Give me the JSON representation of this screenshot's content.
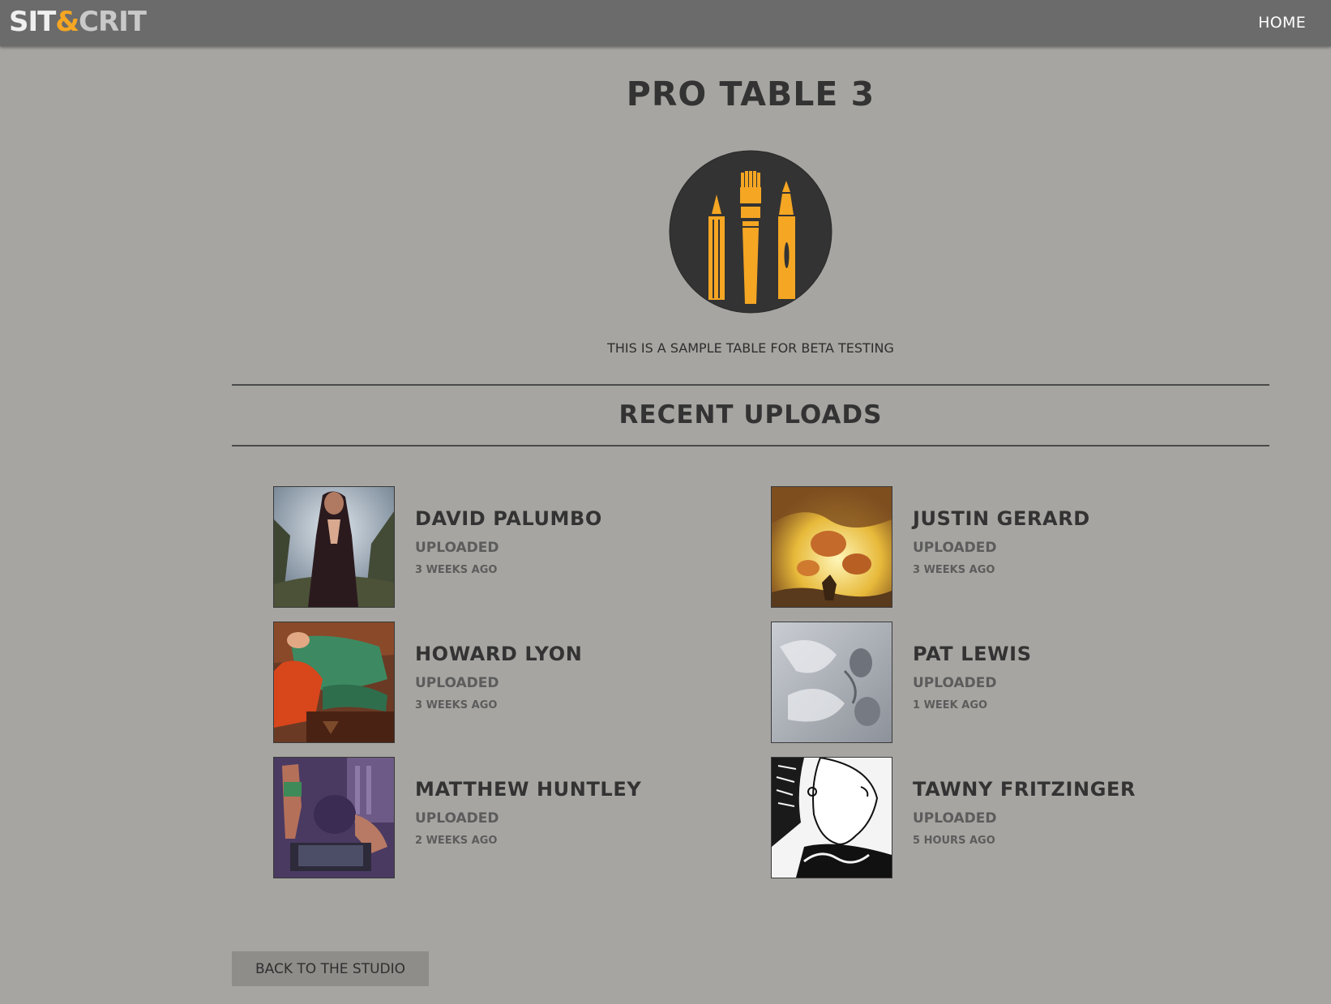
{
  "colors": {
    "page_background": "#a6a5a1",
    "topbar": "#6b6b6b",
    "accent": "#f5a623",
    "text_dark": "#333333",
    "text_muted": "#5c5c5c"
  },
  "header": {
    "logo": {
      "part1": "SIT",
      "part2": "&",
      "part3": "CRIT"
    },
    "nav": {
      "home_label": "HOME"
    }
  },
  "main": {
    "title": "PRO TABLE 3",
    "table_icon": "pencil-brush-pen-icon",
    "description": "THIS IS A SAMPLE TABLE FOR BETA TESTING",
    "recent_uploads": {
      "heading": "RECENT UPLOADS",
      "items": [
        {
          "artist": "DAVID PALUMBO",
          "status": "UPLOADED",
          "time": "3 WEEKS AGO"
        },
        {
          "artist": "JUSTIN GERARD",
          "status": "UPLOADED",
          "time": "3 WEEKS AGO"
        },
        {
          "artist": "HOWARD LYON",
          "status": "UPLOADED",
          "time": "3 WEEKS AGO"
        },
        {
          "artist": "PAT LEWIS",
          "status": "UPLOADED",
          "time": "1 WEEK AGO"
        },
        {
          "artist": "MATTHEW HUNTLEY",
          "status": "UPLOADED",
          "time": "2 WEEKS AGO"
        },
        {
          "artist": "TAWNY FRITZINGER",
          "status": "UPLOADED",
          "time": "5 HOURS AGO"
        }
      ]
    },
    "back_button_label": "BACK TO THE STUDIO"
  }
}
